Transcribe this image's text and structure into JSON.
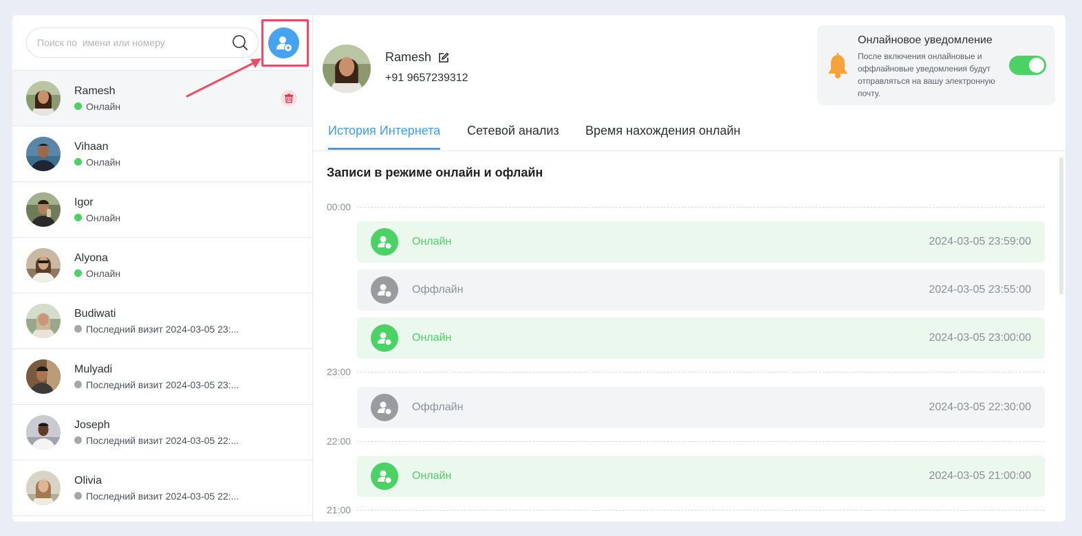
{
  "search": {
    "placeholder": "Поиск по  имени или номеру"
  },
  "contacts": [
    {
      "name": "Ramesh",
      "status": "Онлайн",
      "online": true
    },
    {
      "name": "Vihaan",
      "status": "Онлайн",
      "online": true
    },
    {
      "name": "Igor",
      "status": "Онлайн",
      "online": true
    },
    {
      "name": "Alyona",
      "status": "Онлайн",
      "online": true
    },
    {
      "name": "Budiwati",
      "status": "Последний визит 2024-03-05 23:...",
      "online": false
    },
    {
      "name": "Mulyadi",
      "status": "Последний визит 2024-03-05 23:...",
      "online": false
    },
    {
      "name": "Joseph",
      "status": "Последний визит 2024-03-05 22:...",
      "online": false
    },
    {
      "name": "Olivia",
      "status": "Последний визит 2024-03-05 22:...",
      "online": false
    }
  ],
  "profile": {
    "name": "Ramesh",
    "phone": "+91 9657239312"
  },
  "notification": {
    "title": "Онлайновое уведомление",
    "description": "После включения онлайновые и оффлайновые уведомления будут отправляться на вашу электронную почту.",
    "enabled": true
  },
  "tabs": [
    {
      "label": "История Интернета",
      "active": true
    },
    {
      "label": "Сетевой анализ",
      "active": false
    },
    {
      "label": "Время нахождения онлайн",
      "active": false
    }
  ],
  "records_title": "Записи в режиме онлайн и офлайн",
  "time_markers": [
    "00:00",
    "23:00",
    "22:00",
    "21:00"
  ],
  "records": [
    {
      "status": "Онлайн",
      "time": "2024-03-05 23:59:00",
      "online": true
    },
    {
      "status": "Оффлайн",
      "time": "2024-03-05 23:55:00",
      "online": false
    },
    {
      "status": "Онлайн",
      "time": "2024-03-05 23:00:00",
      "online": true
    },
    {
      "status": "Оффлайн",
      "time": "2024-03-05 22:30:00",
      "online": false
    },
    {
      "status": "Онлайн",
      "time": "2024-03-05 21:00:00",
      "online": true
    }
  ],
  "colors": {
    "accent": "#3f9ef0",
    "online": "#4cd264",
    "offline": "#999b9f",
    "highlight": "#ef4a63"
  }
}
